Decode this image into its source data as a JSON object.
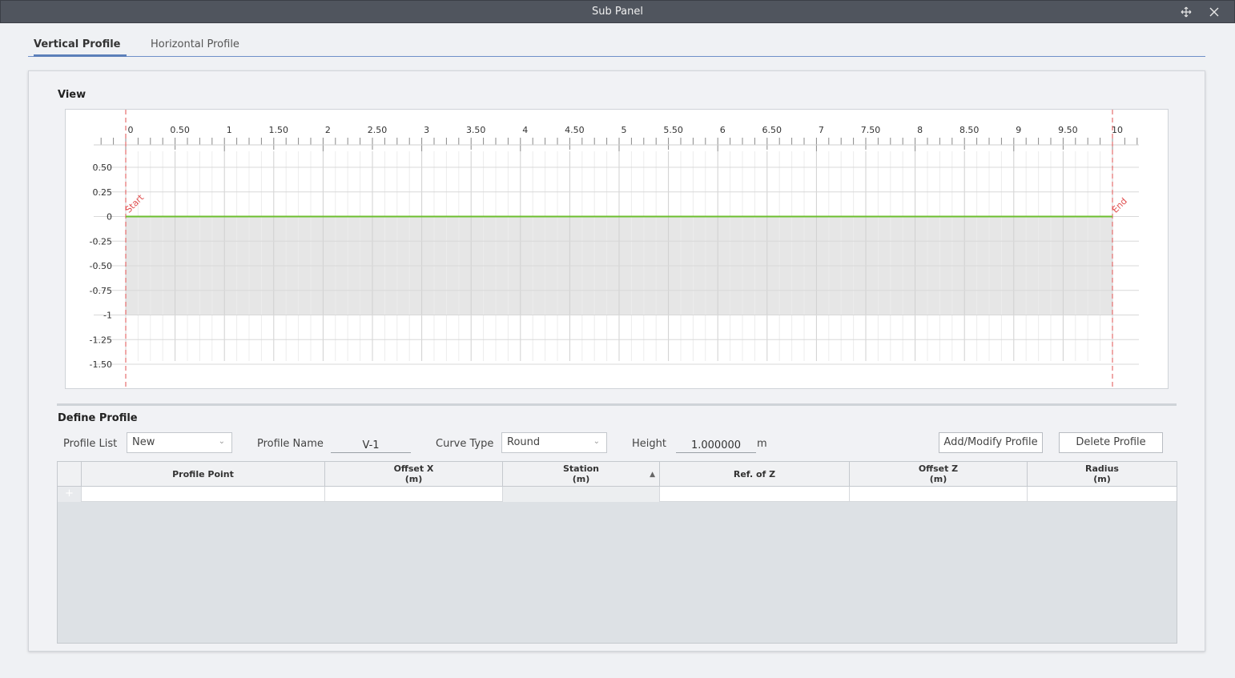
{
  "window": {
    "title": "Sub Panel",
    "move_icon": "move-icon",
    "close_icon": "close-icon"
  },
  "tabs": [
    {
      "label": "Vertical Profile",
      "active": true
    },
    {
      "label": "Horizontal Profile",
      "active": false
    }
  ],
  "view": {
    "title": "View",
    "start_label": "Start",
    "end_label": "End",
    "chart_data": {
      "type": "line",
      "x_ticks": [
        "0",
        "0.50",
        "1",
        "1.50",
        "2",
        "2.50",
        "3",
        "3.50",
        "4",
        "4.50",
        "5",
        "5.50",
        "6",
        "6.50",
        "7",
        "7.50",
        "8",
        "8.50",
        "9",
        "9.50",
        "10"
      ],
      "y_ticks": [
        "0.50",
        "0.25",
        "0",
        "-0.25",
        "-0.50",
        "-0.75",
        "-1",
        "-1.25",
        "-1.50"
      ],
      "xlim": [
        0,
        10
      ],
      "ylim": [
        -1.5,
        0.5
      ],
      "series": [
        {
          "x": [
            0,
            10
          ],
          "y": [
            0,
            0
          ]
        }
      ],
      "fill_region": {
        "x": [
          0,
          10
        ],
        "y": [
          -1,
          0
        ]
      },
      "colors": {
        "line": "#6cbf2f",
        "fill": "#e6e6e6",
        "markers": "#e05050"
      }
    }
  },
  "define": {
    "title": "Define Profile",
    "profile_list_label": "Profile List",
    "profile_list_value": "New",
    "profile_name_label": "Profile Name",
    "profile_name_value": "V-1",
    "curve_type_label": "Curve Type",
    "curve_type_value": "Round",
    "height_label": "Height",
    "height_value": "1.000000",
    "height_unit": "m",
    "add_button": "Add/Modify Profile",
    "delete_button": "Delete Profile"
  },
  "table": {
    "columns": [
      {
        "line1": "Profile Point",
        "line2": ""
      },
      {
        "line1": "Offset X",
        "line2": "(m)"
      },
      {
        "line1": "Station",
        "line2": "(m)"
      },
      {
        "line1": "Ref. of Z",
        "line2": ""
      },
      {
        "line1": "Offset Z",
        "line2": "(m)"
      },
      {
        "line1": "Radius",
        "line2": "(m)"
      }
    ],
    "new_row_marker": "+"
  }
}
